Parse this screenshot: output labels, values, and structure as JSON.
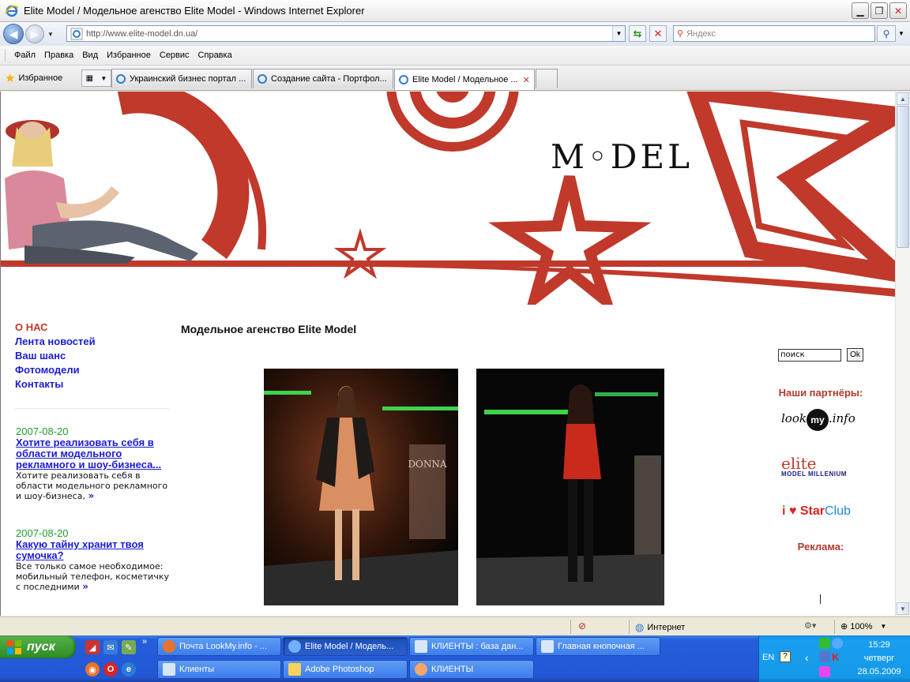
{
  "window": {
    "title": "Elite Model / Модельное агенство Elite Model - Windows Internet Explorer",
    "address": "http://www.elite-model.dn.ua/",
    "search_placeholder": "Яндекс"
  },
  "menu": [
    "Файл",
    "Правка",
    "Вид",
    "Избранное",
    "Сервис",
    "Справка"
  ],
  "favorites_label": "Избранное",
  "tabs": [
    {
      "label": "Украинский бизнес портал ..."
    },
    {
      "label": "Создание сайта - Портфол..."
    },
    {
      "label": "Elite Model / Модельное ..."
    }
  ],
  "page": {
    "logo": "M◦DEL",
    "title": "Модельное агенство Elite Model",
    "nav": [
      {
        "label": "О НАС"
      },
      {
        "label": "Лента новостей"
      },
      {
        "label": "Ваш шанс"
      },
      {
        "label": "Фотомодели"
      },
      {
        "label": "Контакты"
      }
    ],
    "news": [
      {
        "date": "2007-08-20",
        "headline": "Хотите реализовать себя в области модельного рекламного и шоу-бизнеса...",
        "text": "Хотите реализовать себя в области модельного рекламного и шоу-бизнеса,",
        "more": "»"
      },
      {
        "date": "2007-08-20",
        "headline": "Какую тайну хранит твоя сумочка?",
        "text": "Все только самое необходимое: мобильный телефон, косметичку с последними",
        "more": "»"
      }
    ],
    "search_value": "поиск",
    "search_button": "Ok",
    "partners_heading": "Наши партнёры:",
    "partners": {
      "lookmy_a": "look",
      "lookmy_b": "my",
      "lookmy_c": ".info",
      "elite_a": "elite",
      "elite_b": "MODEL MILLENIUM",
      "starclub_a": "i",
      "starclub_b": "Star",
      "starclub_c": "Club"
    },
    "ads_heading": "Реклама:",
    "photo_sign": "DONNA"
  },
  "status": {
    "zone": "Интернет",
    "zoom": "100%"
  },
  "taskbar": {
    "start": "пуск",
    "buttons_row1": [
      {
        "label": "Почта LookMy.info - ..."
      },
      {
        "label": "Elite Model / Модель..."
      },
      {
        "label": "КЛИЕНТЫ : база дан..."
      },
      {
        "label": "Главная кнопочная ..."
      }
    ],
    "buttons_row2": [
      {
        "label": "Клиенты"
      },
      {
        "label": "Adobe Photoshop"
      },
      {
        "label": "КЛИЕНТЫ"
      }
    ],
    "lang": "EN",
    "time": "15:29",
    "day": "четверг",
    "date": "28.05.2009"
  },
  "colors": {
    "accent_red": "#c0392b",
    "link_blue": "#1b1bd6",
    "news_green": "#1f9d2f"
  }
}
